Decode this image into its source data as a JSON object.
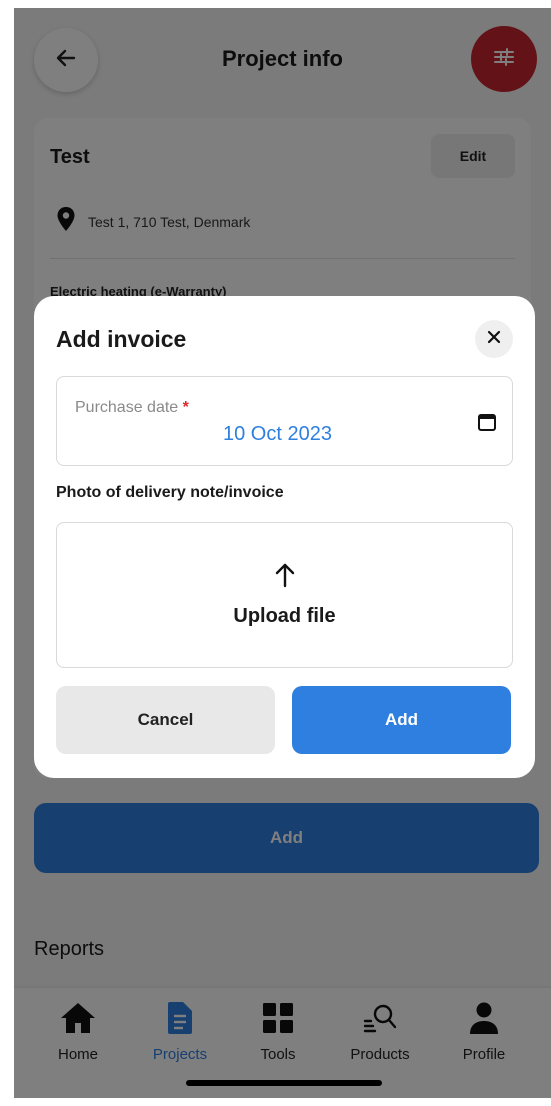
{
  "header": {
    "title": "Project info"
  },
  "project": {
    "name": "Test",
    "edit_label": "Edit",
    "address": "Test 1, 710 Test, Denmark",
    "warranty_type": "Electric heating (e-Warranty)"
  },
  "page": {
    "add_label": "Add",
    "reports_title": "Reports"
  },
  "modal": {
    "title": "Add invoice",
    "purchase_date_label": "Purchase date",
    "required_marker": "*",
    "purchase_date_value": "10 Oct 2023",
    "photo_label": "Photo of delivery note/invoice",
    "upload_label": "Upload file",
    "cancel_label": "Cancel",
    "add_label": "Add"
  },
  "nav": {
    "items": [
      {
        "label": "Home",
        "icon": "home-icon"
      },
      {
        "label": "Projects",
        "icon": "document-icon",
        "active": true
      },
      {
        "label": "Tools",
        "icon": "grid-icon"
      },
      {
        "label": "Products",
        "icon": "search-list-icon"
      },
      {
        "label": "Profile",
        "icon": "person-icon"
      }
    ]
  },
  "colors": {
    "accent": "#2f7fe0",
    "filter_button": "#c6262e",
    "required": "#e02b2b"
  }
}
